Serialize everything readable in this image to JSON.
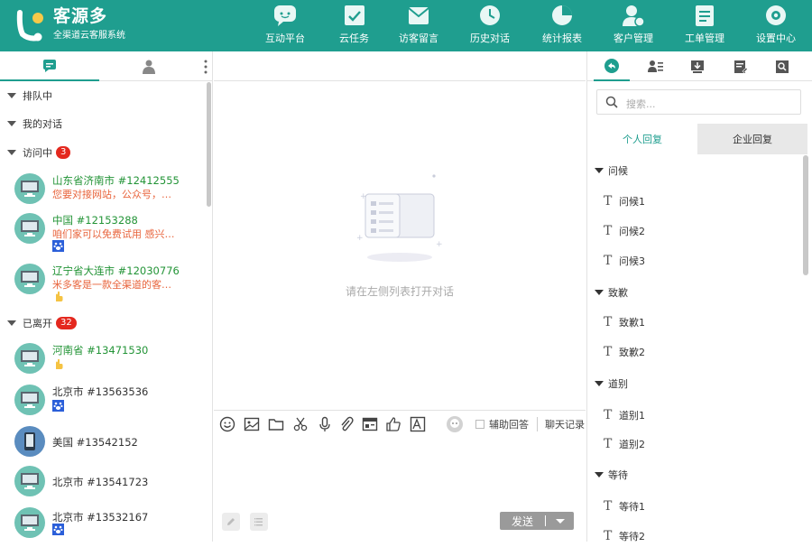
{
  "brand": {
    "name": "客源多",
    "subtitle": "全渠道云客服系统"
  },
  "nav": [
    {
      "label": "互动平台",
      "icon": "chat-bubble-icon"
    },
    {
      "label": "云任务",
      "icon": "task-check-icon"
    },
    {
      "label": "访客留言",
      "icon": "envelope-icon"
    },
    {
      "label": "历史对话",
      "icon": "history-clock-icon"
    },
    {
      "label": "统计报表",
      "icon": "pie-chart-icon"
    },
    {
      "label": "客户管理",
      "icon": "customer-icon"
    },
    {
      "label": "工单管理",
      "icon": "work-order-icon"
    },
    {
      "label": "设置中心",
      "icon": "settings-icon"
    }
  ],
  "left": {
    "groups": {
      "queue": "排队中",
      "mine": "我的对话",
      "visiting": "访问中",
      "visiting_count": "3",
      "left": "已离开",
      "left_count": "32"
    },
    "visiting": [
      {
        "name": "山东省济南市 #12412555",
        "msg": "您要对接网站，公众号，…",
        "source": ""
      },
      {
        "name": "中国 #12153288",
        "msg": "咱们家可以免费试用 感兴…",
        "source": "baidu"
      },
      {
        "name": "辽宁省大连市 #12030776",
        "msg": "米多客是一款全渠道的客…",
        "source": "hand"
      }
    ],
    "left_list": [
      {
        "name": "河南省 #13471530",
        "source": "hand",
        "device": "pc"
      },
      {
        "name": "北京市 #13563536",
        "source": "baidu",
        "device": "pc"
      },
      {
        "name": "美国 #13542152",
        "source": "",
        "device": "mobile"
      },
      {
        "name": "北京市 #13541723",
        "source": "",
        "device": "pc"
      },
      {
        "name": "北京市 #13532167",
        "source": "baidu",
        "device": "pc"
      }
    ]
  },
  "center": {
    "empty_text": "请在左侧列表打开对话",
    "assist_label": "辅助回答",
    "history_label": "聊天记录",
    "send_label": "发送"
  },
  "right": {
    "search_placeholder": "搜索...",
    "tab_personal": "个人回复",
    "tab_company": "企业回复",
    "groups": [
      {
        "title": "问候",
        "items": [
          "问候1",
          "问候2",
          "问候3"
        ]
      },
      {
        "title": "致歉",
        "items": [
          "致歉1",
          "致歉2"
        ]
      },
      {
        "title": "道别",
        "items": [
          "道别1",
          "道别2"
        ]
      },
      {
        "title": "等待",
        "items": [
          "等待1",
          "等待2"
        ]
      }
    ]
  },
  "colors": {
    "brand": "#1f9e8f",
    "visitor_name": "#239437",
    "visitor_msg": "#e8643c",
    "badge": "#e4281e"
  }
}
